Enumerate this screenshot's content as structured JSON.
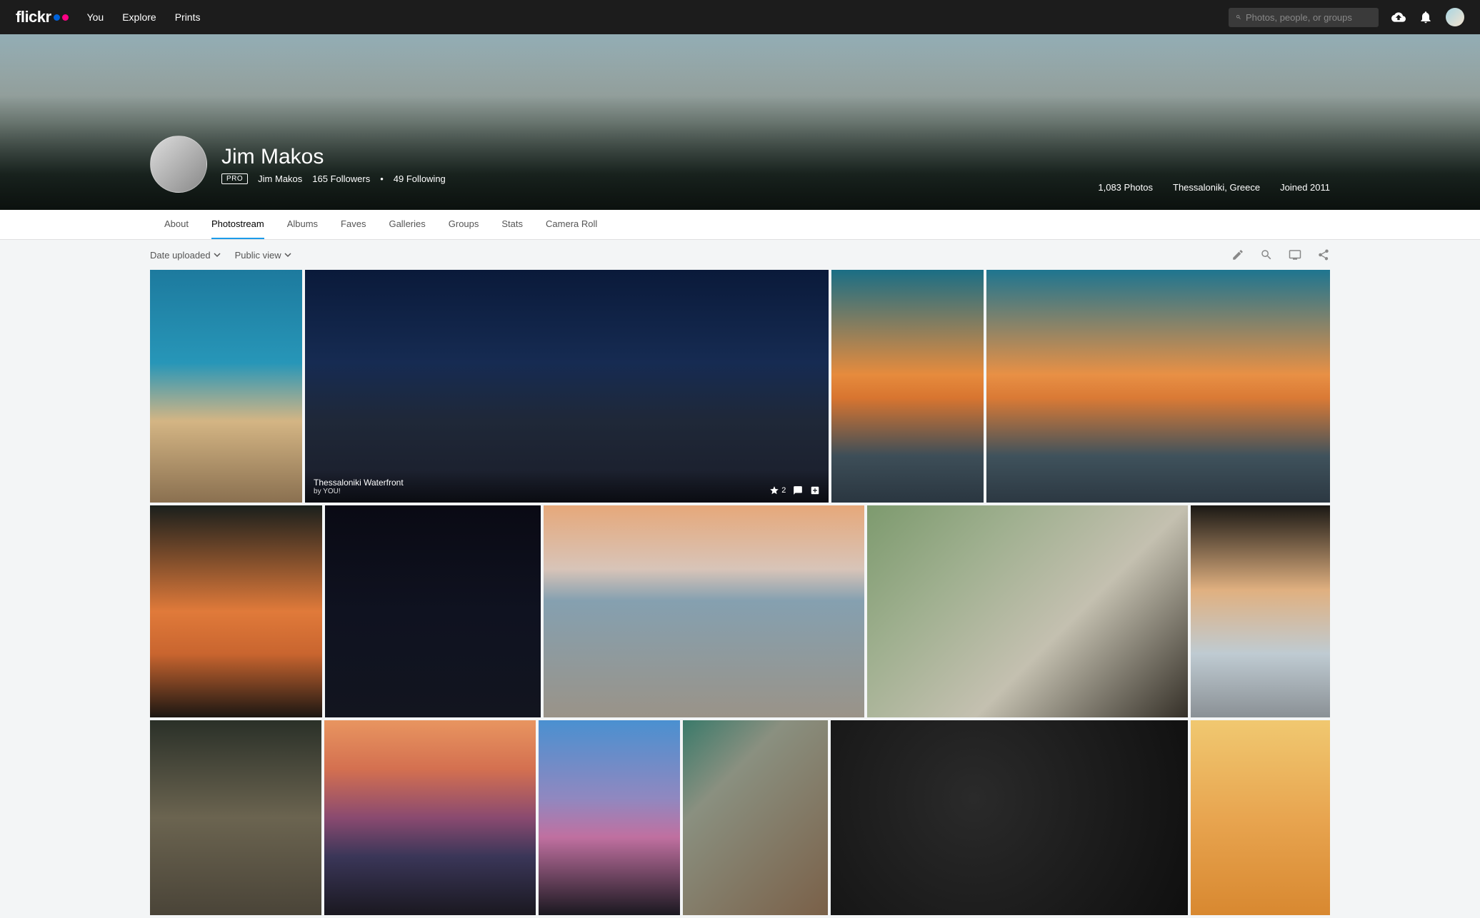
{
  "brand": "flickr",
  "nav": [
    "You",
    "Explore",
    "Prints"
  ],
  "search": {
    "placeholder": "Photos, people, or groups"
  },
  "profile": {
    "name": "Jim Makos",
    "badge": "PRO",
    "username": "Jim Makos",
    "followers": "165 Followers",
    "sep": "•",
    "following": "49 Following",
    "photos": "1,083 Photos",
    "location": "Thessaloniki, Greece",
    "joined": "Joined 2011"
  },
  "tabs": [
    "About",
    "Photostream",
    "Albums",
    "Faves",
    "Galleries",
    "Groups",
    "Stats",
    "Camera Roll"
  ],
  "activeTab": "Photostream",
  "sort": {
    "date": "Date uploaded",
    "view": "Public view"
  },
  "hoverPhoto": {
    "title": "Thessaloniki Waterfront",
    "by": "by YOU!",
    "favs": "2"
  }
}
